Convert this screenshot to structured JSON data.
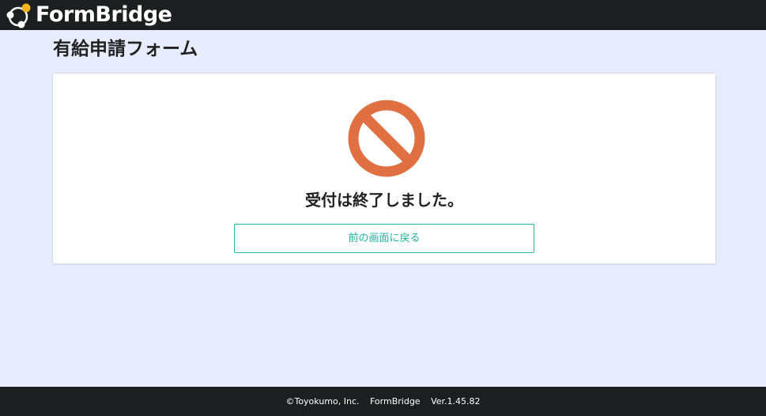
{
  "header": {
    "logo_text": "FormBridge",
    "logo_icon": "formbridge-logo-icon"
  },
  "page": {
    "title": "有給申請フォーム"
  },
  "card": {
    "icon": "ban-icon",
    "message": "受付は終了しました。",
    "back_button_label": "前の画面に戻る"
  },
  "footer": {
    "copyright": "©Toyokumo, Inc.",
    "product": "FormBridge",
    "version": "Ver.1.45.82"
  },
  "colors": {
    "header_bg": "#1d1e20",
    "page_bg": "#e8edfd",
    "ban_icon": "#e07041",
    "accent": "#25b8a6",
    "logo_dot": "#f5b51e"
  }
}
